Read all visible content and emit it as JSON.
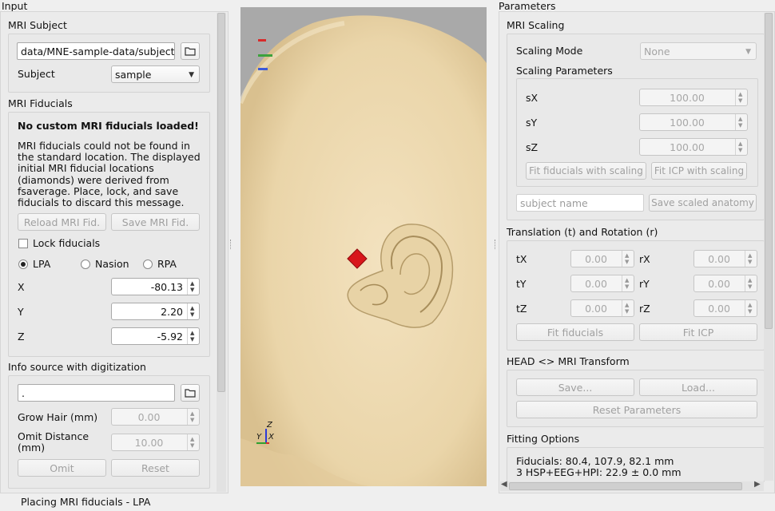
{
  "input_dock": {
    "title": "Input",
    "mri_subject": {
      "title": "MRI Subject",
      "subjects_dir": "data/MNE-sample-data/subjects",
      "subject_label": "Subject",
      "subject_value": "sample"
    },
    "mri_fiducials": {
      "title": "MRI Fiducials",
      "warning_title": "No custom MRI fiducials loaded!",
      "warning_lines": [
        "MRI fiducials could not be found in",
        "the standard location. The displayed",
        "initial MRI fiducial locations",
        "(diamonds) were derived from",
        "fsaverage. Place, lock, and save",
        "fiducials to discard this message."
      ],
      "reload_label": "Reload MRI Fid.",
      "save_label": "Save MRI Fid.",
      "lock_label": "Lock fiducials",
      "radio_lpa": "LPA",
      "radio_nasion": "Nasion",
      "radio_rpa": "RPA",
      "x_label": "X",
      "x_value": "-80.13",
      "y_label": "Y",
      "y_value": "2.20",
      "z_label": "Z",
      "z_value": "-5.92"
    },
    "info_source": {
      "title": "Info source with digitization",
      "path_value": ".",
      "grow_hair_label": "Grow Hair (mm)",
      "grow_hair_value": "0.00",
      "omit_distance_label_1": "Omit Distance",
      "omit_distance_label_2": "(mm)",
      "omit_distance_value": "10.00",
      "omit_label": "Omit",
      "reset_label": "Reset"
    }
  },
  "viewer": {
    "axes_labels": {
      "z": "Z",
      "y": "Y",
      "x": "X"
    },
    "colors": {
      "background": "#a9a9a9",
      "head": "#efdcb4",
      "marker": "#d8161b"
    }
  },
  "params_dock": {
    "title": "Parameters",
    "mri_scaling": {
      "title": "MRI Scaling",
      "mode_label": "Scaling Mode",
      "mode_value": "None",
      "params_title": "Scaling Parameters",
      "sx_label": "sX",
      "sx_value": "100.00",
      "sy_label": "sY",
      "sy_value": "100.00",
      "sz_label": "sZ",
      "sz_value": "100.00",
      "fit_fid_scaling_label": "Fit fiducials with scaling",
      "fit_icp_scaling_label": "Fit ICP with scaling",
      "subject_name_placeholder": "subject name",
      "save_scaled_label": "Save scaled anatomy"
    },
    "translation": {
      "title": "Translation (t) and Rotation (r)",
      "tx_label": "tX",
      "tx_value": "0.00",
      "ty_label": "tY",
      "ty_value": "0.00",
      "tz_label": "tZ",
      "tz_value": "0.00",
      "rx_label": "rX",
      "rx_value": "0.00",
      "ry_label": "rY",
      "ry_value": "0.00",
      "rz_label": "rZ",
      "rz_value": "0.00",
      "fit_fiducials_label": "Fit fiducials",
      "fit_icp_label": "Fit ICP"
    },
    "transform": {
      "title": "HEAD <> MRI Transform",
      "save_label": "Save...",
      "load_label": "Load...",
      "reset_label": "Reset Parameters"
    },
    "fitting": {
      "title": "Fitting Options",
      "line1": "Fiducials: 80.4, 107.9, 82.1 mm",
      "line2": "3 HSP+EEG+HPI: 22.9 ± 0.0 mm"
    }
  },
  "status_bar": {
    "text": "Placing MRI fiducials - LPA"
  }
}
